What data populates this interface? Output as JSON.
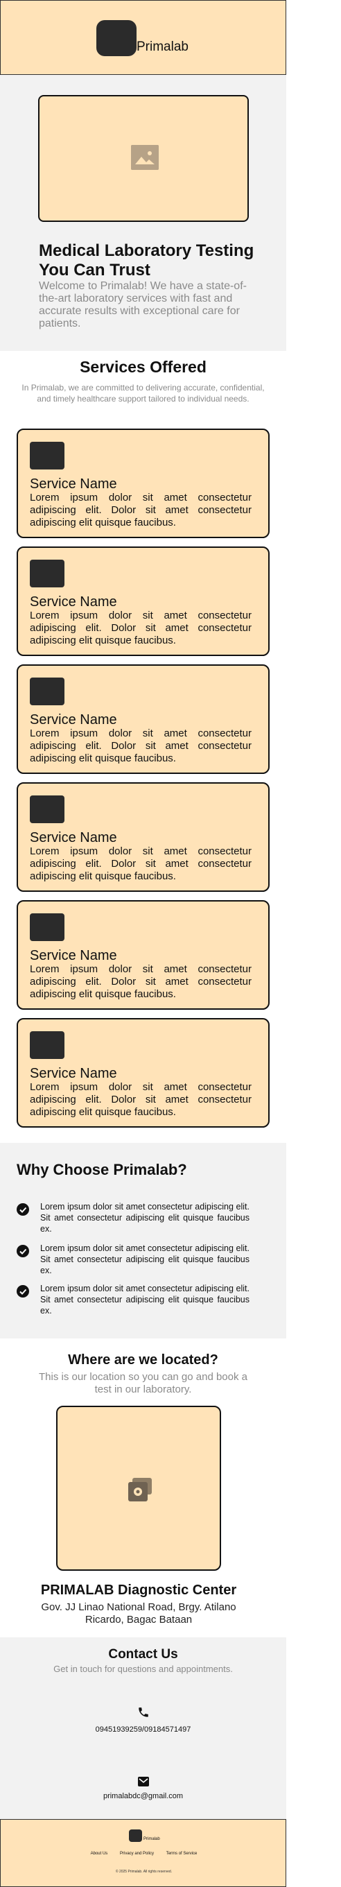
{
  "header": {
    "brand": "Primalab"
  },
  "hero": {
    "title": "Medical Laboratory Testing You Can Trust",
    "subtitle": "Welcome to Primalab! We have a state-of-the-art laboratory services with fast and accurate results with exceptional care for patients."
  },
  "services": {
    "heading": "Services Offered",
    "intro": "In Primalab, we are committed to delivering accurate, confidential, and timely healthcare support tailored to individual needs.",
    "items": [
      {
        "name": "Service Name",
        "description": "Lorem ipsum dolor sit amet consectetur adipiscing elit. Dolor sit amet consectetur adipiscing elit quisque faucibus."
      },
      {
        "name": "Service Name",
        "description": "Lorem ipsum dolor sit amet consectetur adipiscing elit. Dolor sit amet consectetur adipiscing elit quisque faucibus."
      },
      {
        "name": "Service Name",
        "description": "Lorem ipsum dolor sit amet consectetur adipiscing elit. Dolor sit amet consectetur adipiscing elit quisque faucibus."
      },
      {
        "name": "Service Name",
        "description": "Lorem ipsum dolor sit amet consectetur adipiscing elit. Dolor sit amet consectetur adipiscing elit quisque faucibus."
      },
      {
        "name": "Service Name",
        "description": "Lorem ipsum dolor sit amet consectetur adipiscing elit. Dolor sit amet consectetur adipiscing elit quisque faucibus."
      },
      {
        "name": "Service Name",
        "description": "Lorem ipsum dolor sit amet consectetur adipiscing elit. Dolor sit amet consectetur adipiscing elit quisque faucibus."
      }
    ]
  },
  "why": {
    "heading": "Why Choose Primalab?",
    "items": [
      "Lorem ipsum dolor sit amet consectetur adipiscing elit. Sit amet consectetur adipiscing elit quisque faucibus ex.",
      "Lorem ipsum dolor sit amet consectetur adipiscing elit. Sit amet consectetur adipiscing elit quisque faucibus ex.",
      "Lorem ipsum dolor sit amet consectetur adipiscing elit. Sit amet consectetur adipiscing elit quisque faucibus ex."
    ]
  },
  "location": {
    "heading": "Where are we located?",
    "intro": "This is our location so you can go and book a test in our laboratory.",
    "name": "PRIMALAB Diagnostic Center",
    "address": "Gov. JJ Linao National Road, Brgy. Atilano Ricardo, Bagac Bataan"
  },
  "contact": {
    "heading": "Contact Us",
    "intro": "Get in touch for questions and appointments.",
    "phone": "09451939259/09184571497",
    "email": "primalabdc@gmail.com"
  },
  "footer": {
    "brand": "Primalab",
    "links": [
      "About Us",
      "Privacy and Policy",
      "Terms of Service"
    ],
    "copyright": "© 2025 Primalab. All rights reserved."
  },
  "colors": {
    "accent": "#ffe3b8",
    "section_bg": "#f2f2f2",
    "dark": "#2b2b2b"
  },
  "icons": {
    "hero_image": "image-placeholder-icon",
    "location_image": "photo-gallery-icon",
    "check": "check-circle-icon",
    "phone": "phone-icon",
    "email": "email-icon"
  }
}
